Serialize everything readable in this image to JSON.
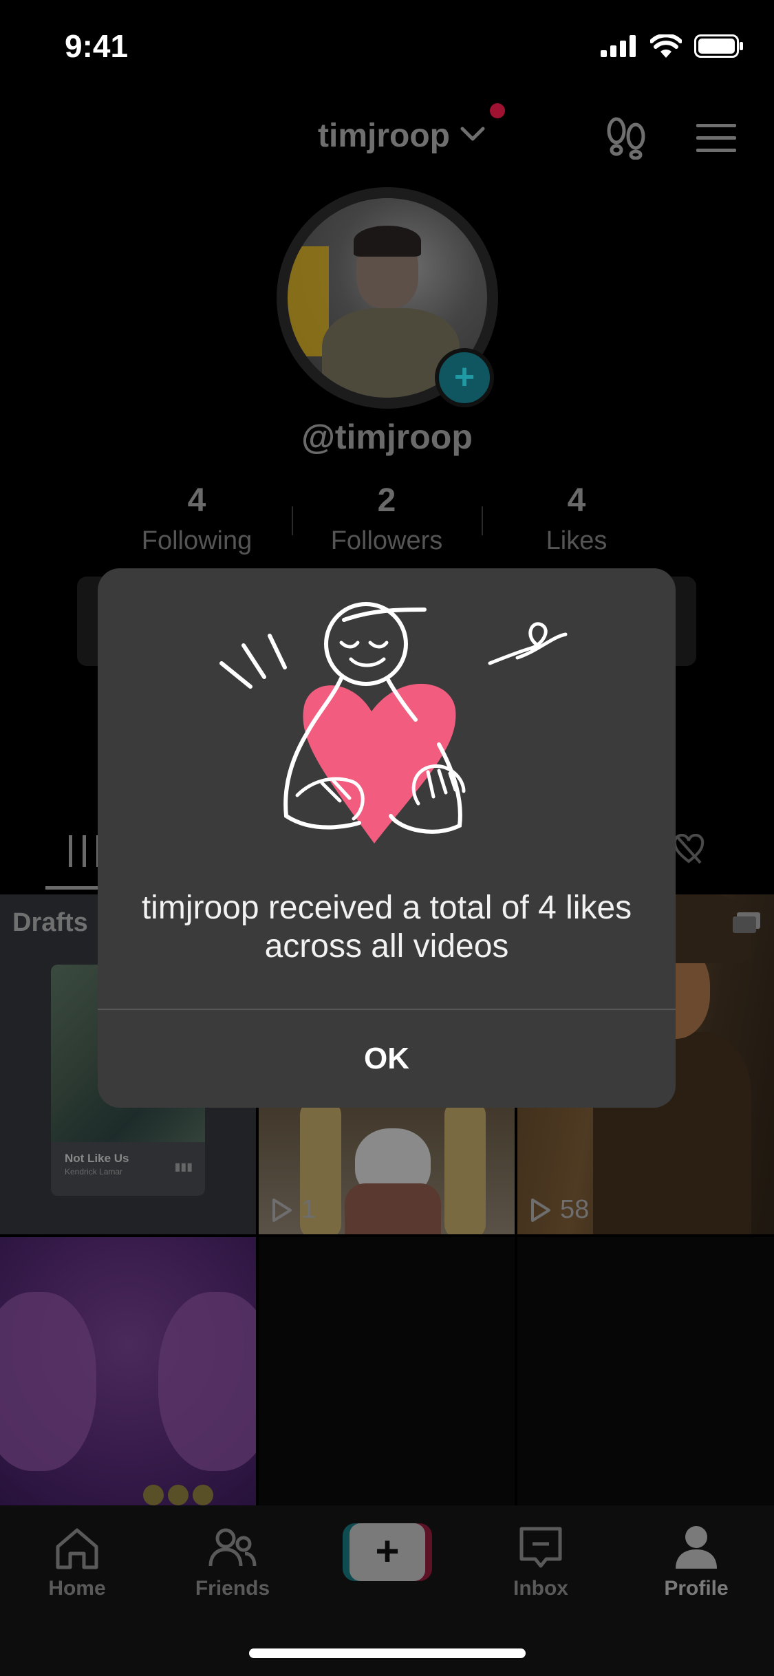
{
  "status_bar": {
    "time": "9:41"
  },
  "header": {
    "username": "timjroop"
  },
  "profile": {
    "handle": "@timjroop"
  },
  "stats": [
    {
      "value": "4",
      "label": "Following"
    },
    {
      "value": "2",
      "label": "Followers"
    },
    {
      "value": "4",
      "label": "Likes"
    }
  ],
  "grid": {
    "drafts_label": "Drafts",
    "draft_music_title": "Not Like Us",
    "draft_music_artist": "Kendrick Lamar",
    "video2_views": "1",
    "video3_views": "58"
  },
  "modal": {
    "message": "timjroop received a total of 4 likes across all videos",
    "ok_label": "OK"
  },
  "tabbar": {
    "home": "Home",
    "friends": "Friends",
    "inbox": "Inbox",
    "profile": "Profile"
  },
  "colors": {
    "heart": "#F25D7F",
    "modal_bg": "#3B3B3B",
    "accent_teal": "#20D5EC",
    "accent_red": "#FE2C55"
  }
}
